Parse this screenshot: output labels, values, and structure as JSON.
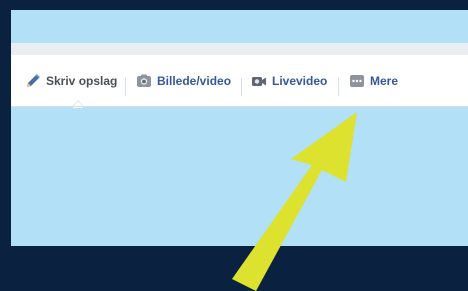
{
  "composer": {
    "tabs": [
      {
        "label": "Skriv opslag",
        "icon": "pencil-icon",
        "color": "#4b4f56"
      },
      {
        "label": "Billede/video",
        "icon": "camera-icon",
        "color": "#365899"
      },
      {
        "label": "Livevideo",
        "icon": "video-camera-icon",
        "color": "#365899"
      },
      {
        "label": "Mere",
        "icon": "more-dots-icon",
        "color": "#365899"
      }
    ]
  },
  "colors": {
    "background": "#0a2140",
    "panel": "#b2e0f6",
    "arrow": "#dce22e"
  }
}
